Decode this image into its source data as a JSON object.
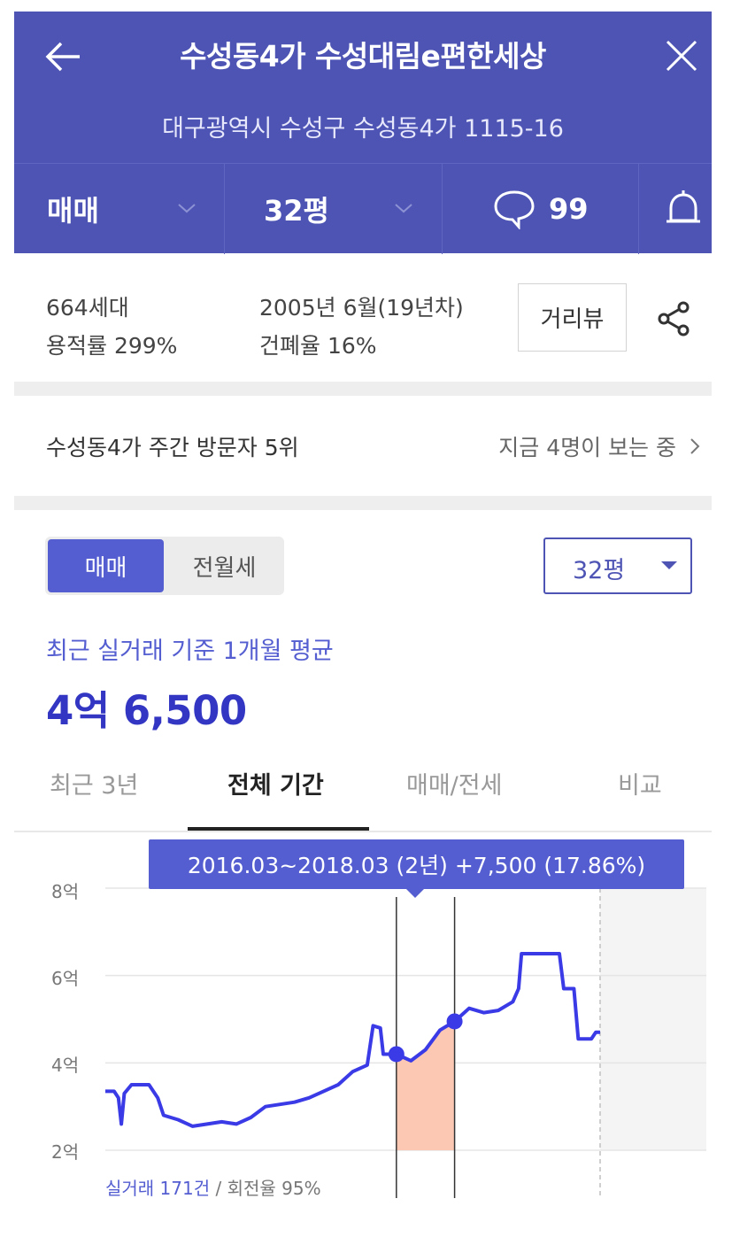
{
  "header": {
    "title": "수성동4가 수성대림e편한세상",
    "address": "대구광역시 수성구 수성동4가 1115-16",
    "trade_type": "매매",
    "size": "32평",
    "comment_count": "99"
  },
  "info": {
    "households": "664세대",
    "floor_area_ratio": "용적률 299%",
    "built": "2005년 6월(19년차)",
    "coverage_ratio": "건폐율 16%",
    "street_view_label": "거리뷰"
  },
  "rank": {
    "text": "수성동4가 주간 방문자 5위",
    "viewers": "지금 4명이 보는 중"
  },
  "price_panel": {
    "segment_options": [
      "매매",
      "전월세"
    ],
    "size_select": "32평",
    "avg_label": "최근 실거래 기준 1개월 평균",
    "avg_value": "4억 6,500"
  },
  "period_tabs": [
    "최근 3년",
    "전체 기간",
    "매매/전세",
    "비교"
  ],
  "active_period_tab": "전체 기간",
  "tooltip": "2016.03~2018.03 (2년)  +7,500 (17.86%)",
  "footer": {
    "trades": "실거래 171건",
    "turnover": " / 회전율 95%"
  },
  "colors": {
    "header": "#4d54b4",
    "accent": "#545ed0",
    "line": "#3a3ae6",
    "highlight": "#fcc8b4"
  },
  "chart_data": {
    "type": "line",
    "ylabel": "",
    "yticks": [
      "8억",
      "6억",
      "4억",
      "2억"
    ],
    "ylim": [
      2,
      8
    ],
    "x_range": [
      "2006",
      "2024"
    ],
    "highlight_range": [
      "2016.03",
      "2018.03"
    ],
    "series": [
      {
        "values": [
          {
            "x": 2006.0,
            "y": 3.35
          },
          {
            "x": 2006.3,
            "y": 3.35
          },
          {
            "x": 2006.45,
            "y": 3.2
          },
          {
            "x": 2006.55,
            "y": 2.6
          },
          {
            "x": 2006.65,
            "y": 3.3
          },
          {
            "x": 2006.9,
            "y": 3.5
          },
          {
            "x": 2007.5,
            "y": 3.5
          },
          {
            "x": 2007.8,
            "y": 3.2
          },
          {
            "x": 2008.0,
            "y": 2.8
          },
          {
            "x": 2008.5,
            "y": 2.7
          },
          {
            "x": 2009.0,
            "y": 2.55
          },
          {
            "x": 2009.5,
            "y": 2.6
          },
          {
            "x": 2010.0,
            "y": 2.65
          },
          {
            "x": 2010.5,
            "y": 2.6
          },
          {
            "x": 2011.0,
            "y": 2.75
          },
          {
            "x": 2011.5,
            "y": 3.0
          },
          {
            "x": 2012.0,
            "y": 3.05
          },
          {
            "x": 2012.5,
            "y": 3.1
          },
          {
            "x": 2013.0,
            "y": 3.2
          },
          {
            "x": 2013.5,
            "y": 3.35
          },
          {
            "x": 2014.0,
            "y": 3.5
          },
          {
            "x": 2014.5,
            "y": 3.8
          },
          {
            "x": 2015.0,
            "y": 3.95
          },
          {
            "x": 2015.2,
            "y": 4.85
          },
          {
            "x": 2015.45,
            "y": 4.8
          },
          {
            "x": 2015.55,
            "y": 4.2
          },
          {
            "x": 2016.0,
            "y": 4.2
          },
          {
            "x": 2016.5,
            "y": 4.05
          },
          {
            "x": 2017.0,
            "y": 4.3
          },
          {
            "x": 2017.5,
            "y": 4.75
          },
          {
            "x": 2018.0,
            "y": 4.95
          },
          {
            "x": 2018.5,
            "y": 5.25
          },
          {
            "x": 2019.0,
            "y": 5.15
          },
          {
            "x": 2019.5,
            "y": 5.2
          },
          {
            "x": 2020.0,
            "y": 5.4
          },
          {
            "x": 2020.2,
            "y": 5.7
          },
          {
            "x": 2020.3,
            "y": 6.5
          },
          {
            "x": 2021.0,
            "y": 6.5
          },
          {
            "x": 2021.6,
            "y": 6.5
          },
          {
            "x": 2021.75,
            "y": 5.7
          },
          {
            "x": 2022.1,
            "y": 5.7
          },
          {
            "x": 2022.25,
            "y": 4.55
          },
          {
            "x": 2022.7,
            "y": 4.55
          },
          {
            "x": 2022.85,
            "y": 4.7
          },
          {
            "x": 2023.0,
            "y": 4.7
          }
        ]
      }
    ],
    "markers": [
      {
        "x": 2016.0,
        "y": 4.2
      },
      {
        "x": 2018.0,
        "y": 4.95
      }
    ]
  }
}
